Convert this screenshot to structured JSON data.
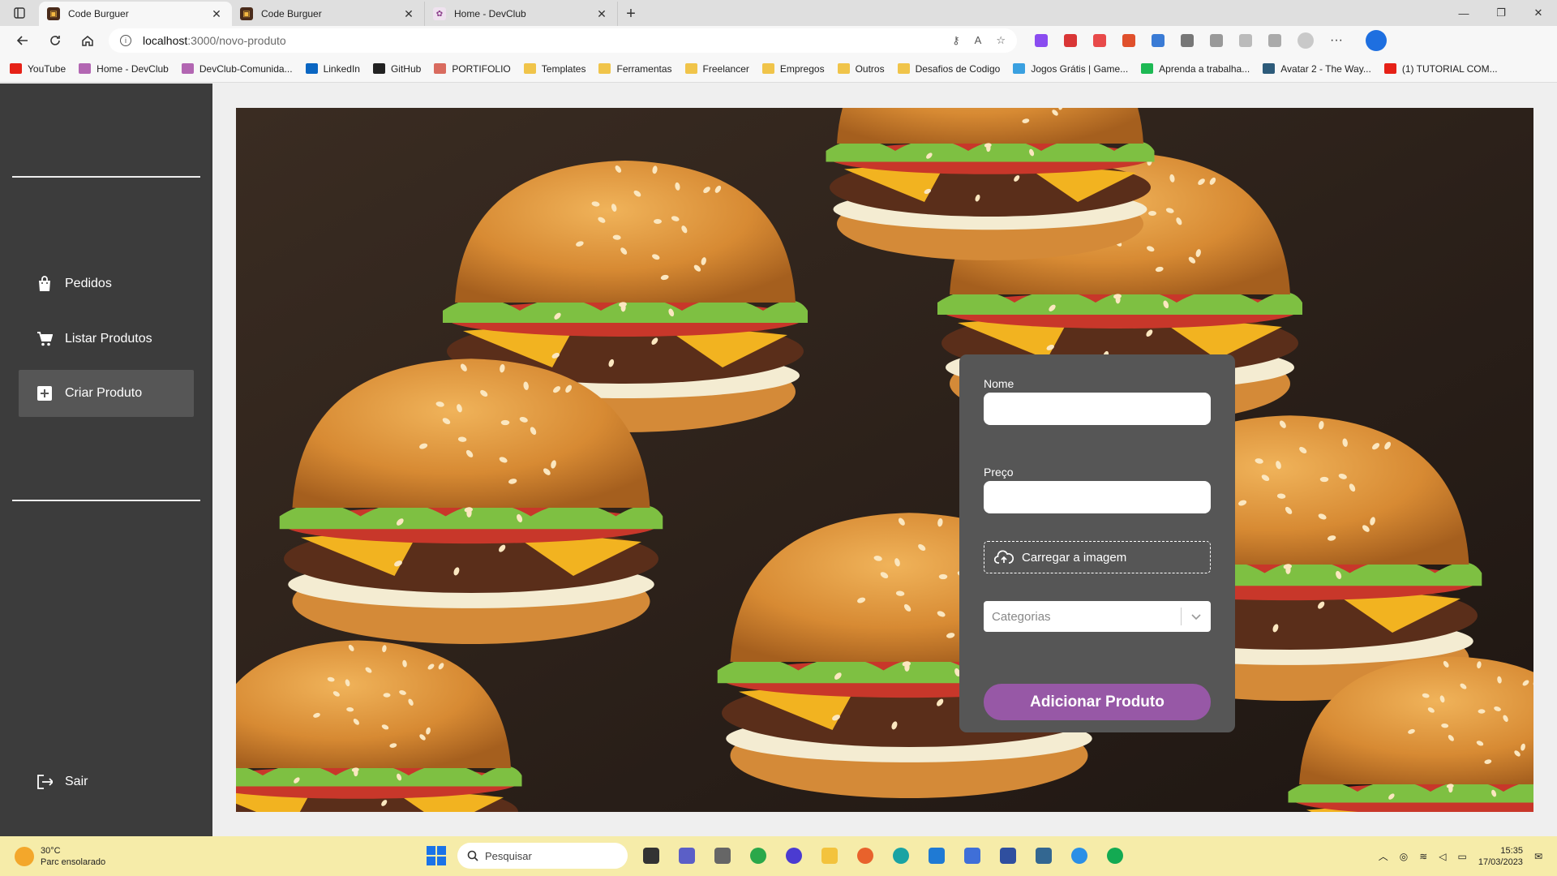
{
  "browser": {
    "tabs": [
      {
        "title": "Code Burguer",
        "active": true
      },
      {
        "title": "Code Burguer",
        "active": false
      },
      {
        "title": "Home - DevClub",
        "active": false
      }
    ],
    "url_host": "localhost",
    "url_path": ":3000/novo-produto",
    "bookmarks": [
      {
        "label": "YouTube",
        "icon": "youtube-icon",
        "color": "#e62117"
      },
      {
        "label": "Home - DevClub",
        "icon": "devclub-icon",
        "color": "#b266b2"
      },
      {
        "label": "DevClub-Comunida...",
        "icon": "devclub-icon",
        "color": "#b266b2"
      },
      {
        "label": "LinkedIn",
        "icon": "linkedin-icon",
        "color": "#0a66c2"
      },
      {
        "label": "GitHub",
        "icon": "github-icon",
        "color": "#222222"
      },
      {
        "label": "PORTIFOLIO",
        "icon": "portfolio-icon",
        "color": "#d96b5f"
      },
      {
        "label": "Templates",
        "icon": "folder-icon",
        "color": "#f0c44a"
      },
      {
        "label": "Ferramentas",
        "icon": "folder-icon",
        "color": "#f0c44a"
      },
      {
        "label": "Freelancer",
        "icon": "folder-icon",
        "color": "#f0c44a"
      },
      {
        "label": "Empregos",
        "icon": "folder-icon",
        "color": "#f0c44a"
      },
      {
        "label": "Outros",
        "icon": "folder-icon",
        "color": "#f0c44a"
      },
      {
        "label": "Desafios de Codigo",
        "icon": "folder-icon",
        "color": "#f0c44a"
      },
      {
        "label": "Jogos Grátis | Game...",
        "icon": "games-icon",
        "color": "#3aa0e0"
      },
      {
        "label": "Aprenda a trabalha...",
        "icon": "learn-icon",
        "color": "#1db954"
      },
      {
        "label": "Avatar 2 - The Way...",
        "icon": "avatar-icon",
        "color": "#2d5b7a"
      },
      {
        "label": "(1) TUTORIAL COM...",
        "icon": "youtube-icon",
        "color": "#e62117"
      }
    ]
  },
  "sidebar": {
    "items": [
      {
        "label": "Pedidos",
        "icon": "shopping-bag-icon",
        "active": false
      },
      {
        "label": "Listar Produtos",
        "icon": "cart-icon",
        "active": false
      },
      {
        "label": "Criar Produto",
        "icon": "add-box-icon",
        "active": true
      }
    ],
    "logout_label": "Sair"
  },
  "form": {
    "name_label": "Nome",
    "name_value": "",
    "price_label": "Preço",
    "price_value": "",
    "upload_label": "Carregar a imagem",
    "category_placeholder": "Categorias",
    "submit_label": "Adicionar Produto"
  },
  "colors": {
    "sidebar_bg": "#3c3c3c",
    "sidebar_active": "#565656",
    "card_bg": "#565656",
    "accent": "#9758a6",
    "taskbar_bg": "#f6eca9"
  },
  "taskbar": {
    "weather_temp": "30°C",
    "weather_desc": "Parc ensolarado",
    "search_placeholder": "Pesquisar",
    "time": "15:35",
    "date": "17/03/2023"
  }
}
